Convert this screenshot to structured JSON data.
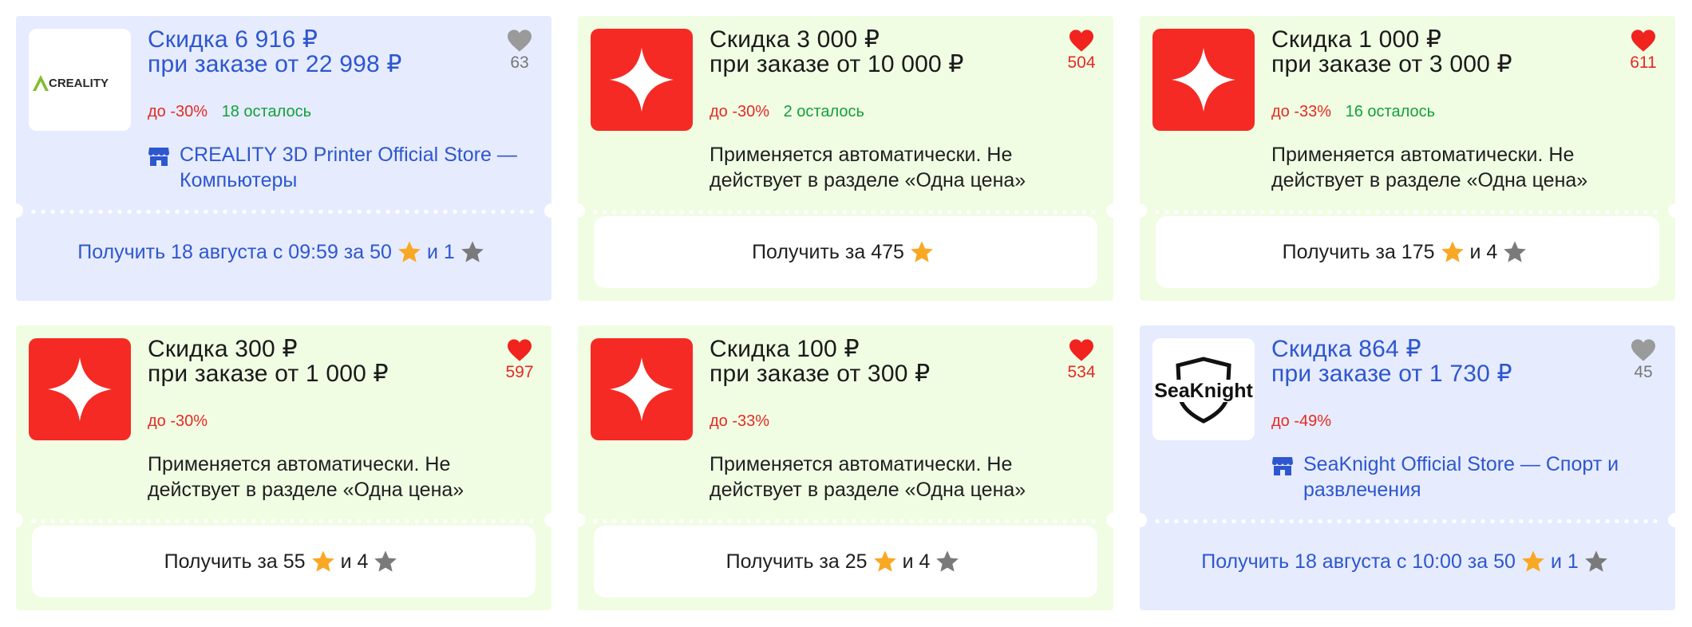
{
  "colors": {
    "store_bg": "#e6ecfe",
    "promo_bg": "#f0fde3",
    "brand_red": "#f52a24",
    "link_blue": "#2e56cf",
    "discount_red": "#e52a22",
    "remaining_green": "#13a03c",
    "gold_star": "#f9a825",
    "grey_star": "#7a7a7a"
  },
  "coupons": [
    {
      "title_line1": "Скидка 6 916 ₽",
      "title_line2": "при заказе от 22 998 ₽",
      "favorites": "63",
      "favorited": false,
      "discount": "до -30%",
      "remaining": "18 осталось",
      "logo_icon": "creality-logo",
      "logo_text": "CREALITY",
      "store_icon": "store-icon",
      "store_link": "CREALITY 3D Printer Official Store — Компьютеры",
      "action_text": "Получить 18 августа с 09:59 за 50",
      "action_and": "и 1"
    },
    {
      "title_line1": "Скидка 3 000 ₽",
      "title_line2": "при заказе от 10 000 ₽",
      "favorites": "504",
      "favorited": true,
      "discount": "до -30%",
      "remaining": "2 осталось",
      "logo_icon": "sparkle-logo",
      "description": "Применяется автоматически. Не действует в разделе «Одна цена»",
      "action_text": "Получить за 475"
    },
    {
      "title_line1": "Скидка 1 000 ₽",
      "title_line2": "при заказе от 3 000 ₽",
      "favorites": "611",
      "favorited": true,
      "discount": "до -33%",
      "remaining": "16 осталось",
      "logo_icon": "sparkle-logo",
      "description": "Применяется автоматически. Не действует в разделе «Одна цена»",
      "action_text": "Получить за 175",
      "action_and": "и 4"
    },
    {
      "title_line1": "Скидка 300 ₽",
      "title_line2": "при заказе от 1 000 ₽",
      "favorites": "597",
      "favorited": true,
      "discount": "до -30%",
      "logo_icon": "sparkle-logo",
      "description": "Применяется автоматически. Не действует в разделе «Одна цена»",
      "action_text": "Получить за 55",
      "action_and": "и 4"
    },
    {
      "title_line1": "Скидка 100 ₽",
      "title_line2": "при заказе от 300 ₽",
      "favorites": "534",
      "favorited": true,
      "discount": "до -33%",
      "logo_icon": "sparkle-logo",
      "description": "Применяется автоматически. Не действует в разделе «Одна цена»",
      "action_text": "Получить за 25",
      "action_and": "и 4"
    },
    {
      "title_line1": "Скидка 864 ₽",
      "title_line2": "при заказе от 1 730 ₽",
      "favorites": "45",
      "favorited": false,
      "discount": "до -49%",
      "logo_icon": "seaknight-logo",
      "logo_text": "SeaKnight",
      "store_icon": "store-icon",
      "store_link": "SeaKnight Official Store — Спорт и развлечения",
      "action_text": "Получить 18 августа с 10:00 за 50",
      "action_and": "и 1"
    }
  ]
}
